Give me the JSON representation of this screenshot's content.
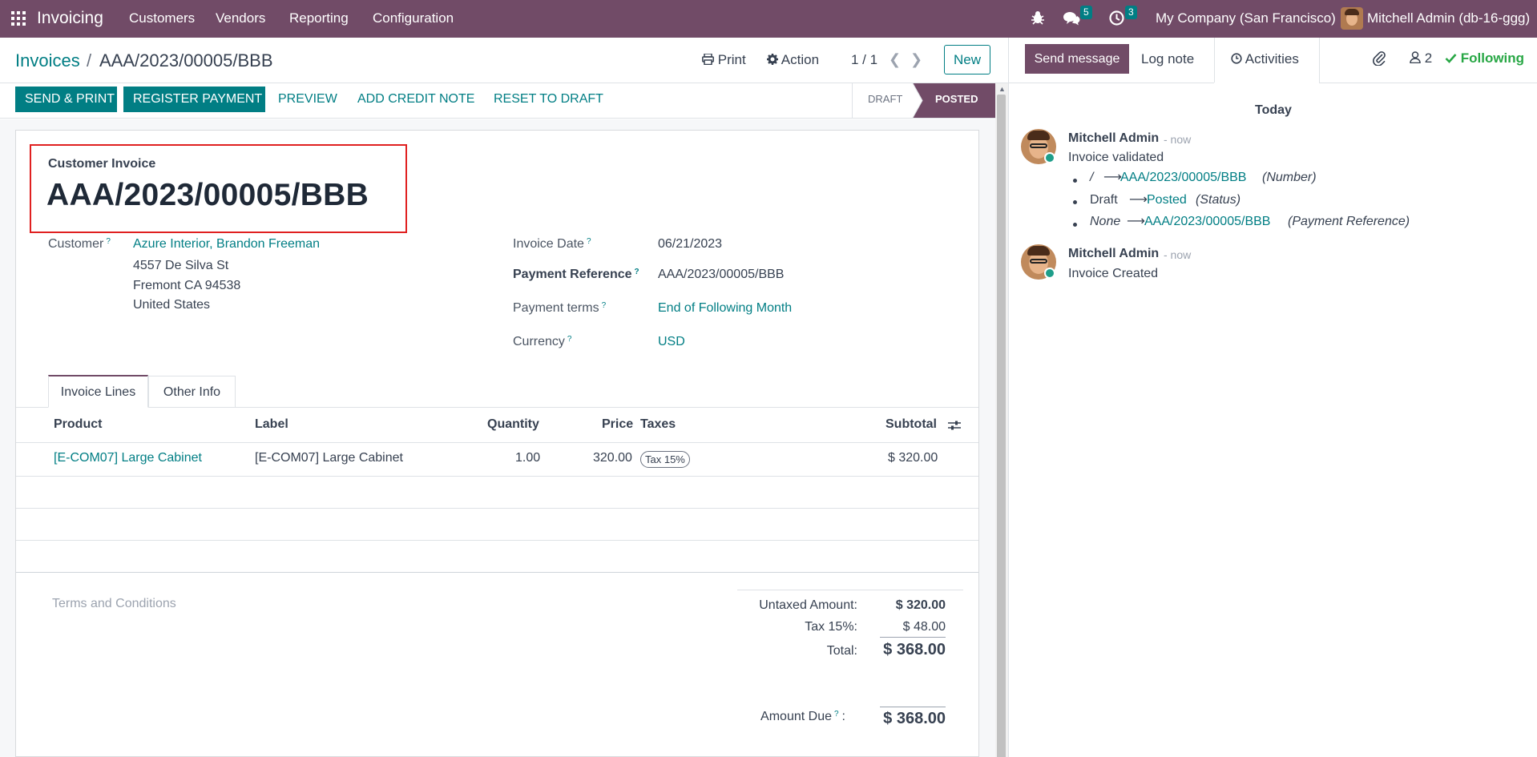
{
  "navbar": {
    "app_name": "Invoicing",
    "menu": [
      "Customers",
      "Vendors",
      "Reporting",
      "Configuration"
    ],
    "messages_count": "5",
    "activities_count": "3",
    "company": "My Company (San Francisco)",
    "user": "Mitchell Admin (db-16-ggg)"
  },
  "breadcrumb": {
    "parent": "Invoices",
    "separator": "/",
    "current": "AAA/2023/00005/BBB"
  },
  "control": {
    "print": "Print",
    "action": "Action",
    "pager": "1 / 1",
    "new": "New"
  },
  "buttons": {
    "send_print": "SEND & PRINT",
    "register_payment": "REGISTER PAYMENT",
    "preview": "PREVIEW",
    "add_credit_note": "ADD CREDIT NOTE",
    "reset_to_draft": "RESET TO DRAFT"
  },
  "statusbar": {
    "draft": "DRAFT",
    "posted": "POSTED",
    "active": "posted"
  },
  "invoice": {
    "type_label": "Customer Invoice",
    "number": "AAA/2023/00005/BBB",
    "customer_label": "Customer",
    "customer_name": "Azure Interior, Brandon Freeman",
    "address_line1": "4557 De Silva St",
    "address_line2": "Fremont CA 94538",
    "address_line3": "United States",
    "invoice_date_label": "Invoice Date",
    "invoice_date": "06/21/2023",
    "payment_reference_label": "Payment Reference",
    "payment_reference": "AAA/2023/00005/BBB",
    "payment_terms_label": "Payment terms",
    "payment_terms": "End of Following Month",
    "currency_label": "Currency",
    "currency": "USD",
    "help_mark": "?"
  },
  "tabs": {
    "invoice_lines": "Invoice Lines",
    "other_info": "Other Info",
    "active": "invoice_lines"
  },
  "lines": {
    "columns": [
      "Product",
      "Label",
      "Quantity",
      "Price",
      "Taxes",
      "Subtotal"
    ],
    "rows": [
      {
        "product": "[E-COM07] Large Cabinet",
        "label": "[E-COM07] Large Cabinet",
        "quantity": "1.00",
        "price": "320.00",
        "tax": "Tax 15%",
        "subtotal": "$ 320.00"
      }
    ]
  },
  "terms_placeholder": "Terms and Conditions",
  "totals": {
    "untaxed_label": "Untaxed Amount:",
    "untaxed_value": "$ 320.00",
    "tax_label": "Tax 15%:",
    "tax_value": "$ 48.00",
    "total_label": "Total:",
    "total_value": "$ 368.00",
    "amount_due_label": "Amount Due",
    "amount_due_suffix": ":",
    "amount_due_value": "$ 368.00"
  },
  "chatter": {
    "send_message": "Send message",
    "log_note": "Log note",
    "activities": "Activities",
    "followers_count": "2",
    "following": "Following",
    "date_separator": "Today",
    "messages": [
      {
        "author": "Mitchell Admin",
        "time": "- now",
        "body": "Invoice validated",
        "changes": [
          {
            "old": "/",
            "new": "AAA/2023/00005/BBB",
            "field": "(Number)"
          },
          {
            "old": "Draft",
            "new": "Posted",
            "field": "(Status)"
          },
          {
            "old": "None",
            "new": "AAA/2023/00005/BBB",
            "field": "(Payment Reference)"
          }
        ]
      },
      {
        "author": "Mitchell Admin",
        "time": "- now",
        "body": "Invoice Created"
      }
    ]
  },
  "colors": {
    "brand": "#714b67",
    "accent": "#017e84",
    "highlight_border": "#e02020"
  }
}
